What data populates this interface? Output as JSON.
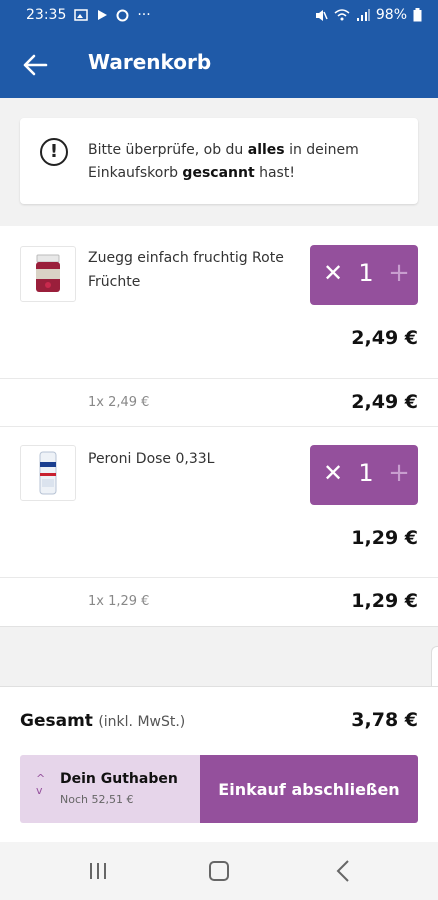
{
  "status_bar": {
    "time": "23:35",
    "battery": "98%"
  },
  "app_bar": {
    "title": "Warenkorb"
  },
  "notice": {
    "t1": "Bitte überprüfe, ob du ",
    "bold1": "alles",
    "t2": " in deinem Einkaufskorb ",
    "bold2": "gescannt",
    "t3": " hast!"
  },
  "items": [
    {
      "name": "Zuegg einfach fruchtig Rote Früchte",
      "quantity": "1",
      "price": "2,49 €",
      "unit_line": "1x 2,49 €",
      "line_total": "2,49 €"
    },
    {
      "name": "Peroni Dose 0,33L",
      "quantity": "1",
      "price": "1,29 €",
      "unit_line": "1x 1,29 €",
      "line_total": "1,29 €"
    }
  ],
  "summary": {
    "label": "Gesamt",
    "sub": "(inkl. MwSt.)",
    "total": "3,78 €"
  },
  "credit": {
    "title": "Dein Guthaben",
    "sub": "Noch 52,51 €"
  },
  "checkout": {
    "label": "Einkauf abschließen"
  },
  "colors": {
    "primary": "#1f5aa8",
    "accent": "#94509c",
    "accent_light": "#e6d5ea"
  }
}
